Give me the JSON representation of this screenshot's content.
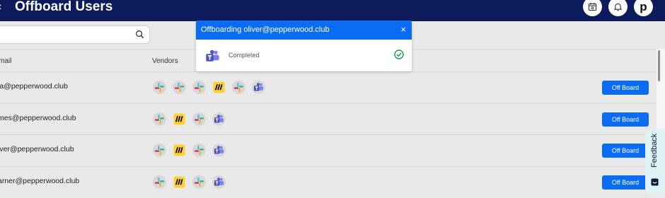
{
  "header": {
    "back_glyph": "‹",
    "title": "Offboard Users",
    "avatar_letter": "p"
  },
  "search": {
    "placeholder": ""
  },
  "table": {
    "columns": {
      "email": "mail",
      "vendors": "Vendors"
    },
    "rows": [
      {
        "email": "ia@pepperwood.club",
        "vendors": [
          "slack",
          "slack",
          "slack",
          "miro",
          "slack",
          "teams"
        ],
        "action": "Off Board"
      },
      {
        "email": "mes@pepperwood.club",
        "vendors": [
          "slack",
          "miro",
          "slack",
          "teams"
        ],
        "action": "Off Board"
      },
      {
        "email": "lver@pepperwood.club",
        "vendors": [
          "slack",
          "miro",
          "slack",
          "teams"
        ],
        "action": "Off Board"
      },
      {
        "email": "arner@pepperwood.club",
        "vendors": [
          "slack",
          "miro",
          "slack",
          "teams"
        ],
        "action": "Off Board"
      }
    ]
  },
  "modal": {
    "title": "Offboarding oliver@pepperwood.club",
    "close_glyph": "×",
    "vendor": "teams",
    "status": "Completed"
  },
  "feedback": {
    "label": "Feedback"
  },
  "colors": {
    "header_bg": "#0d1a5c",
    "primary": "#0a6cf2",
    "success": "#16a34a",
    "feedback_bg": "#dff2f4"
  }
}
